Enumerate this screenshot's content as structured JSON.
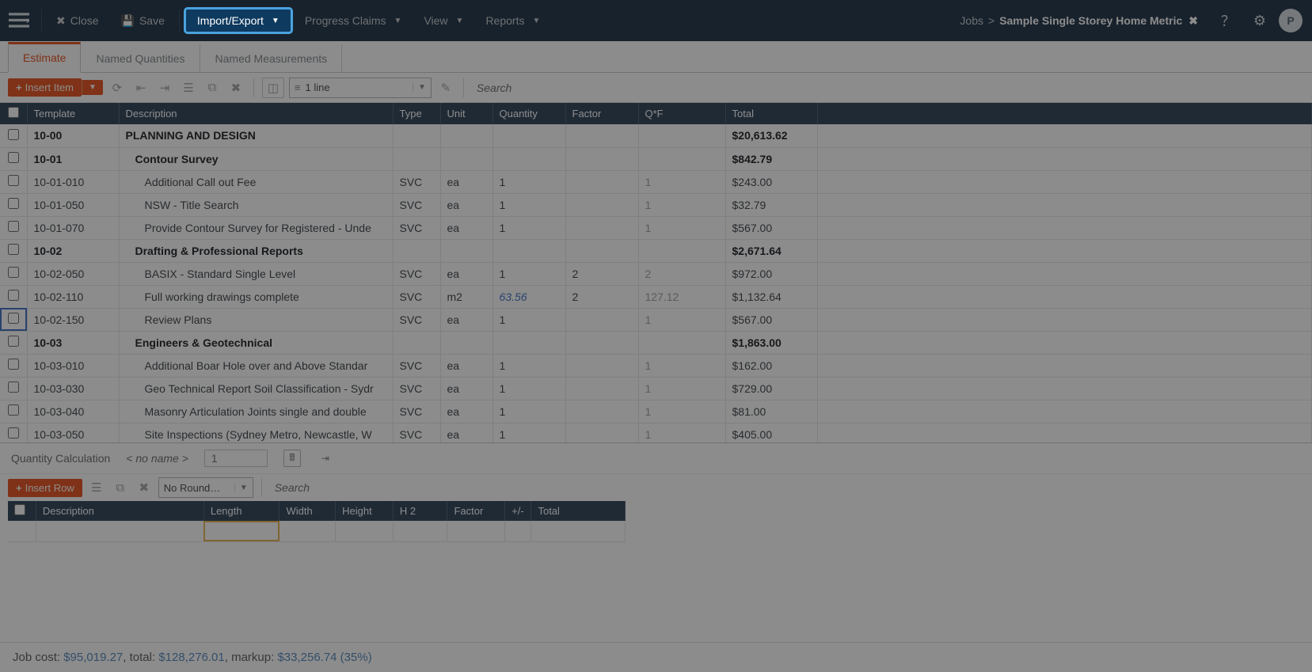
{
  "topbar": {
    "close": "Close",
    "save": "Save",
    "import_export": "Import/Export",
    "progress_claims": "Progress Claims",
    "view": "View",
    "reports": "Reports"
  },
  "breadcrumb": {
    "root": "Jobs",
    "sep": ">",
    "job": "Sample Single Storey Home Metric"
  },
  "avatar_letter": "P",
  "tabs": [
    {
      "label": "Estimate",
      "active": true
    },
    {
      "label": "Named Quantities",
      "active": false
    },
    {
      "label": "Named Measurements",
      "active": false
    }
  ],
  "toolbar": {
    "insert_item": "Insert Item",
    "line_select": "1 line",
    "search_placeholder": "Search"
  },
  "grid": {
    "headers": {
      "template": "Template",
      "description": "Description",
      "type": "Type",
      "unit": "Unit",
      "quantity": "Quantity",
      "factor": "Factor",
      "qf": "Q*F",
      "total": "Total"
    },
    "rows": [
      {
        "bold": true,
        "indent": 0,
        "tpl": "10-00",
        "desc": "PLANNING AND DESIGN",
        "type": "",
        "unit": "",
        "qty": "",
        "fac": "",
        "qf": "",
        "total": "$20,613.62"
      },
      {
        "bold": true,
        "indent": 1,
        "tpl": "10-01",
        "desc": "Contour Survey",
        "type": "",
        "unit": "",
        "qty": "",
        "fac": "",
        "qf": "",
        "total": "$842.79"
      },
      {
        "bold": false,
        "indent": 2,
        "tpl": "10-01-010",
        "desc": "Additional Call out Fee",
        "type": "SVC",
        "unit": "ea",
        "qty": "1",
        "fac": "",
        "qf": "1",
        "total": "$243.00"
      },
      {
        "bold": false,
        "indent": 2,
        "tpl": "10-01-050",
        "desc": "NSW - Title Search",
        "type": "SVC",
        "unit": "ea",
        "qty": "1",
        "fac": "",
        "qf": "1",
        "total": "$32.79"
      },
      {
        "bold": false,
        "indent": 2,
        "tpl": "10-01-070",
        "desc": "Provide Contour Survey for Registered - Unde",
        "type": "SVC",
        "unit": "ea",
        "qty": "1",
        "fac": "",
        "qf": "1",
        "total": "$567.00"
      },
      {
        "bold": true,
        "indent": 1,
        "tpl": "10-02",
        "desc": "Drafting & Professional Reports",
        "type": "",
        "unit": "",
        "qty": "",
        "fac": "",
        "qf": "",
        "total": "$2,671.64"
      },
      {
        "bold": false,
        "indent": 2,
        "tpl": "10-02-050",
        "desc": "BASIX - Standard Single Level",
        "type": "SVC",
        "unit": "ea",
        "qty": "1",
        "fac": "2",
        "qf": "2",
        "total": "$972.00"
      },
      {
        "bold": false,
        "indent": 2,
        "tpl": "10-02-110",
        "desc": "Full working drawings complete",
        "type": "SVC",
        "unit": "m2",
        "qty": "63.56",
        "qlink": true,
        "fac": "2",
        "qf": "127.12",
        "total": "$1,132.64"
      },
      {
        "bold": false,
        "indent": 2,
        "sel": true,
        "tpl": "10-02-150",
        "desc": "Review Plans",
        "type": "SVC",
        "unit": "ea",
        "qty": "1",
        "fac": "",
        "qf": "1",
        "total": "$567.00"
      },
      {
        "bold": true,
        "indent": 1,
        "tpl": "10-03",
        "desc": "Engineers & Geotechnical",
        "type": "",
        "unit": "",
        "qty": "",
        "fac": "",
        "qf": "",
        "total": "$1,863.00"
      },
      {
        "bold": false,
        "indent": 2,
        "tpl": "10-03-010",
        "desc": "Additional Boar Hole over and Above Standar",
        "type": "SVC",
        "unit": "ea",
        "qty": "1",
        "fac": "",
        "qf": "1",
        "total": "$162.00"
      },
      {
        "bold": false,
        "indent": 2,
        "tpl": "10-03-030",
        "desc": "Geo Technical Report Soil Classification - Sydr",
        "type": "SVC",
        "unit": "ea",
        "qty": "1",
        "fac": "",
        "qf": "1",
        "total": "$729.00"
      },
      {
        "bold": false,
        "indent": 2,
        "tpl": "10-03-040",
        "desc": "Masonry Articulation Joints single and double",
        "type": "SVC",
        "unit": "ea",
        "qty": "1",
        "fac": "",
        "qf": "1",
        "total": "$81.00"
      },
      {
        "bold": false,
        "indent": 2,
        "tpl": "10-03-050",
        "desc": "Site Inspections (Sydney Metro, Newcastle, W",
        "type": "SVC",
        "unit": "ea",
        "qty": "1",
        "fac": "",
        "qf": "1",
        "total": "$405.00"
      }
    ]
  },
  "calc": {
    "title": "Quantity Calculation",
    "noname": "< no name >",
    "page": "1",
    "insert_row": "Insert Row",
    "round_label": "No Round…",
    "search_placeholder": "Search",
    "headers": {
      "description": "Description",
      "length": "Length",
      "width": "Width",
      "height": "Height",
      "h2": "H 2",
      "factor": "Factor",
      "pm": "+/-",
      "total": "Total"
    }
  },
  "footer": {
    "job_cost_label": "Job cost:",
    "job_cost": "$95,019.27",
    "total_label": ", total:",
    "total": "$128,276.01",
    "markup_label": ", markup:",
    "markup": "$33,256.74 (35%)"
  }
}
